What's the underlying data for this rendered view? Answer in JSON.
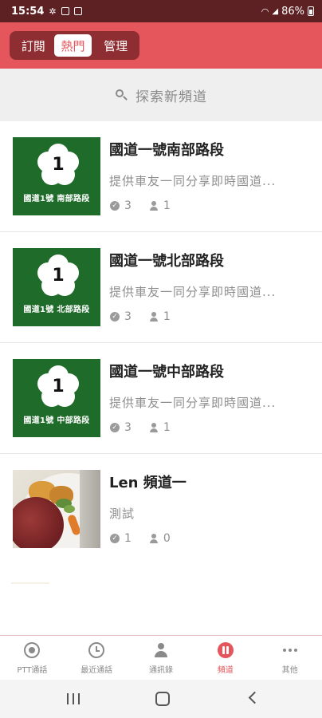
{
  "status_bar": {
    "time": "15:54",
    "battery": "86%"
  },
  "header": {
    "tabs": [
      {
        "label": "訂閱",
        "active": false
      },
      {
        "label": "熱門",
        "active": true
      },
      {
        "label": "管理",
        "active": false
      }
    ]
  },
  "search": {
    "placeholder": "探索新頻道"
  },
  "channels": [
    {
      "title": "國道一號南部路段",
      "description": "提供車友一同分享即時國道...",
      "checks": "3",
      "users": "1",
      "image_caption": "國道1號 南部路段",
      "badge_number": "1",
      "image_icon": "highway-sign"
    },
    {
      "title": "國道一號北部路段",
      "description": "提供車友一同分享即時國道...",
      "checks": "3",
      "users": "1",
      "image_caption": "國道1號 北部路段",
      "badge_number": "1",
      "image_icon": "highway-sign"
    },
    {
      "title": "國道一號中部路段",
      "description": "提供車友一同分享即時國道...",
      "checks": "3",
      "users": "1",
      "image_caption": "國道1號 中部路段",
      "badge_number": "1",
      "image_icon": "highway-sign"
    },
    {
      "title": "Len 頻道一",
      "description": "測試",
      "checks": "1",
      "users": "0",
      "image_icon": "food-photo"
    }
  ],
  "bottom_tabs": [
    {
      "label": "PTT通話",
      "icon": "ptt-icon",
      "active": false
    },
    {
      "label": "最近通話",
      "icon": "recent-calls-icon",
      "active": false
    },
    {
      "label": "通訊錄",
      "icon": "contacts-icon",
      "active": false
    },
    {
      "label": "頻道",
      "icon": "channel-icon",
      "active": true
    },
    {
      "label": "其他",
      "icon": "more-icon",
      "active": false
    }
  ],
  "colors": {
    "primary": "#e4565b",
    "segment_bg": "#8f2e32",
    "status_bar": "#5e2123",
    "highway_green": "#1f6b2a"
  }
}
